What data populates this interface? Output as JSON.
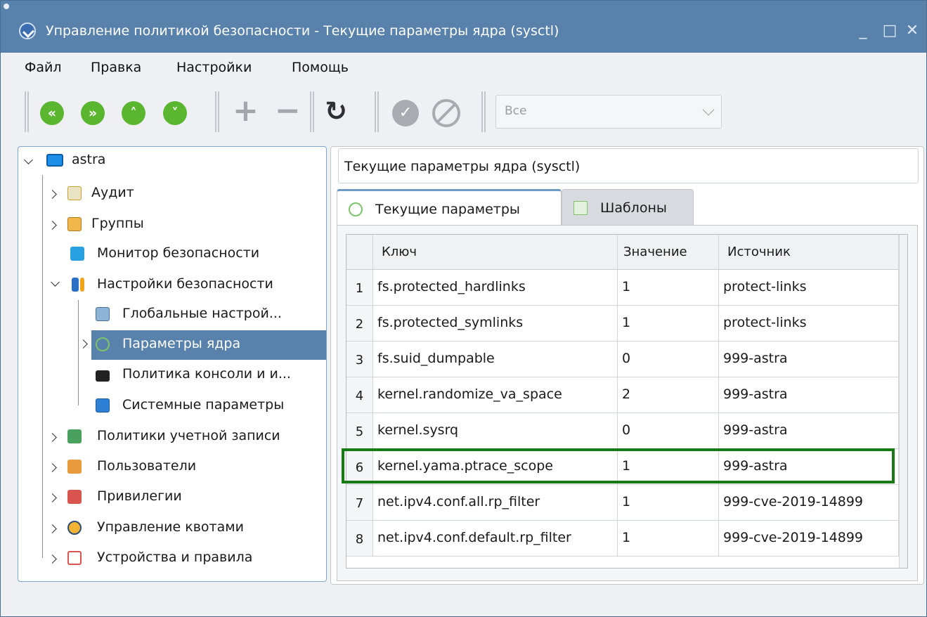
{
  "window": {
    "title": "Управление политикой безопасности - Текущие параметры ядра (sysctl)",
    "minimize": "_",
    "maximize": "□",
    "close": "✕"
  },
  "menu": {
    "file": "Файл",
    "edit": "Правка",
    "settings": "Настройки",
    "help": "Помощь"
  },
  "toolbar": {
    "first_glyph": "«",
    "last_glyph": "»",
    "up_glyph": "˄",
    "down_glyph": "˅",
    "add_glyph": "+",
    "remove_glyph": "−",
    "refresh_glyph": "↻",
    "apply_glyph": "✓",
    "filter_value": "Все"
  },
  "tree": {
    "root": "astra",
    "items": [
      {
        "label": "Аудит"
      },
      {
        "label": "Группы"
      },
      {
        "label": "Монитор безопасности"
      },
      {
        "label": "Настройки безопасности"
      },
      {
        "label": "Глобальные настрой..."
      },
      {
        "label": "Параметры ядра"
      },
      {
        "label": "Политика консоли и и..."
      },
      {
        "label": "Системные параметры"
      },
      {
        "label": "Политики учетной записи"
      },
      {
        "label": "Пользователи"
      },
      {
        "label": "Привилегии"
      },
      {
        "label": "Управление квотами"
      },
      {
        "label": "Устройства и правила"
      }
    ]
  },
  "panel": {
    "title": "Текущие параметры ядра (sysctl)",
    "tabs": [
      "Текущие параметры",
      "Шаблоны"
    ]
  },
  "table": {
    "columns": [
      "Ключ",
      "Значение",
      "Источник"
    ],
    "rows": [
      {
        "num": "1",
        "key": "fs.protected_hardlinks",
        "value": "1",
        "source": "protect-links"
      },
      {
        "num": "2",
        "key": "fs.protected_symlinks",
        "value": "1",
        "source": "protect-links"
      },
      {
        "num": "3",
        "key": "fs.suid_dumpable",
        "value": "0",
        "source": "999-astra"
      },
      {
        "num": "4",
        "key": "kernel.randomize_va_space",
        "value": "2",
        "source": "999-astra"
      },
      {
        "num": "5",
        "key": "kernel.sysrq",
        "value": "0",
        "source": "999-astra"
      },
      {
        "num": "6",
        "key": "kernel.yama.ptrace_scope",
        "value": "1",
        "source": "999-astra"
      },
      {
        "num": "7",
        "key": "net.ipv4.conf.all.rp_filter",
        "value": "1",
        "source": "999-cve-2019-14899"
      },
      {
        "num": "8",
        "key": "net.ipv4.conf.default.rp_filter",
        "value": "1",
        "source": "999-cve-2019-14899"
      }
    ]
  },
  "colors": {
    "titlebar": "#5882ac",
    "selection": "#5882ac",
    "green_button": "#5ab52f",
    "highlight_border": "#177a17"
  }
}
